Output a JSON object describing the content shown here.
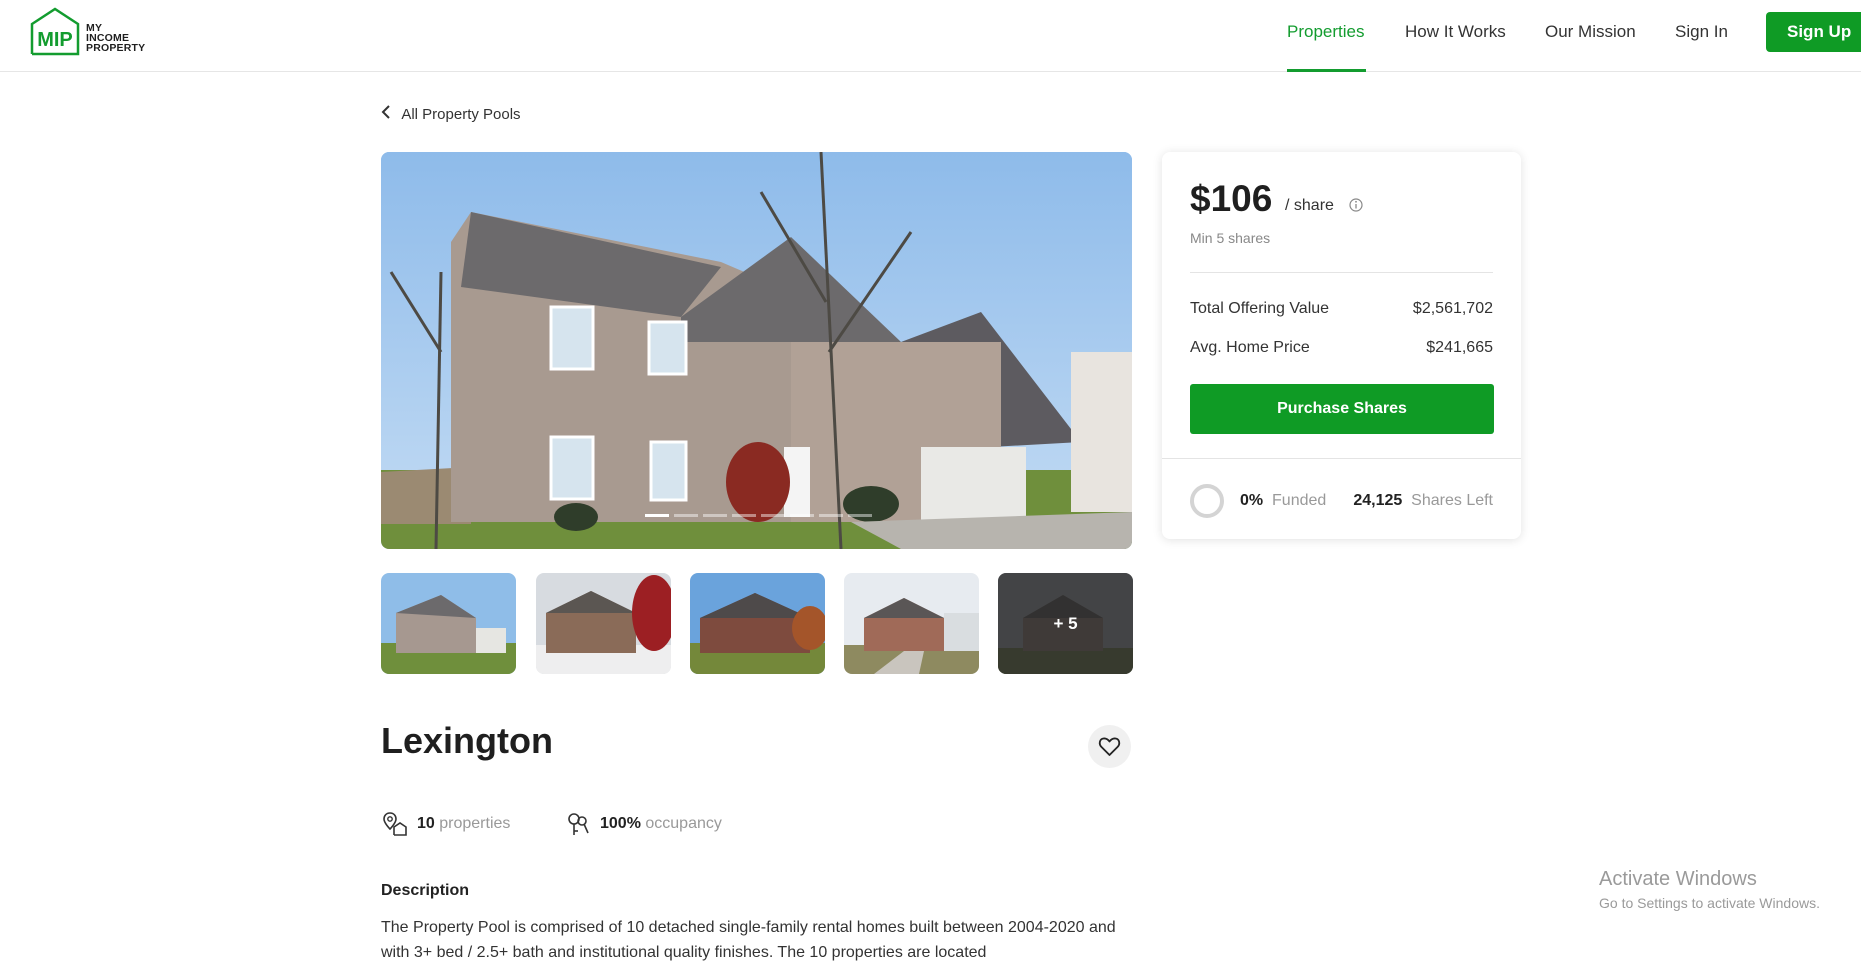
{
  "header": {
    "logo": {
      "mark": "MIP",
      "line1": "MY",
      "line2": "INCOME",
      "line3": "PROPERTY"
    },
    "nav": [
      "Properties",
      "How It Works",
      "Our Mission",
      "Sign In"
    ],
    "signup_label": "Sign Up"
  },
  "back_label": "All Property Pools",
  "gallery": {
    "slide_count": 8,
    "active_slide": 1,
    "more_label": "+ 5"
  },
  "property": {
    "name": "Lexington",
    "properties_count": "10",
    "properties_label": "properties",
    "occupancy_value": "100%",
    "occupancy_label": "occupancy",
    "description_heading": "Description",
    "description": "The Property Pool is comprised of 10 detached single-family rental homes built between 2004-2020 and with 3+ bed / 2.5+ bath and institutional quality finishes. The 10 properties are located"
  },
  "offer": {
    "price": "$106",
    "per_share": "/ share",
    "min_shares": "Min 5 shares",
    "total_offering_label": "Total Offering Value",
    "total_offering_value": "$2,561,702",
    "avg_price_label": "Avg. Home Price",
    "avg_price_value": "$241,665",
    "purchase_label": "Purchase Shares",
    "funded_pct": "0%",
    "funded_label": "Funded",
    "shares_left_value": "24,125",
    "shares_left_label": "Shares Left"
  },
  "os_watermark": {
    "line1": "Activate Windows",
    "line2": "Go to Settings to activate Windows."
  },
  "colors": {
    "brand_green": "#0f9b25",
    "nav_active": "#139c2f"
  }
}
